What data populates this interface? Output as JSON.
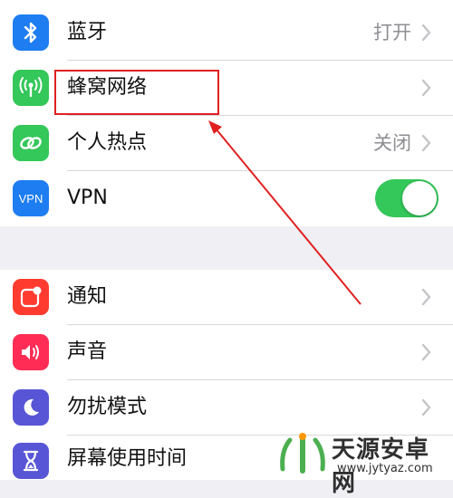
{
  "settings": {
    "group1": [
      {
        "label": "蓝牙",
        "value": "打开",
        "icon": "bluetooth-icon",
        "color": "#1e7df0",
        "control": "chevron"
      },
      {
        "label": "蜂窝网络",
        "value": "",
        "icon": "cellular-antenna-icon",
        "color": "#34c759",
        "control": "chevron"
      },
      {
        "label": "个人热点",
        "value": "关闭",
        "icon": "hotspot-link-icon",
        "color": "#34c759",
        "control": "chevron"
      },
      {
        "label": "VPN",
        "value": "",
        "icon": "vpn-icon",
        "icon_text": "VPN",
        "color": "#1e7df0",
        "control": "toggle",
        "toggle_on": true
      }
    ],
    "group2": [
      {
        "label": "通知",
        "icon": "notification-icon",
        "color": "#ff3b30",
        "control": "chevron"
      },
      {
        "label": "声音",
        "icon": "speaker-icon",
        "color": "#ff2d55",
        "control": "chevron"
      },
      {
        "label": "勿扰模式",
        "icon": "moon-icon",
        "color": "#5856d6",
        "control": "chevron"
      },
      {
        "label": "屏幕使用时间",
        "icon": "hourglass-icon",
        "color": "#5856d6",
        "control": "chevron"
      }
    ]
  },
  "annotation": {
    "highlight_color": "#e02020"
  },
  "watermark": {
    "name": "天源安卓网",
    "url": "www.jytyaz.com"
  }
}
